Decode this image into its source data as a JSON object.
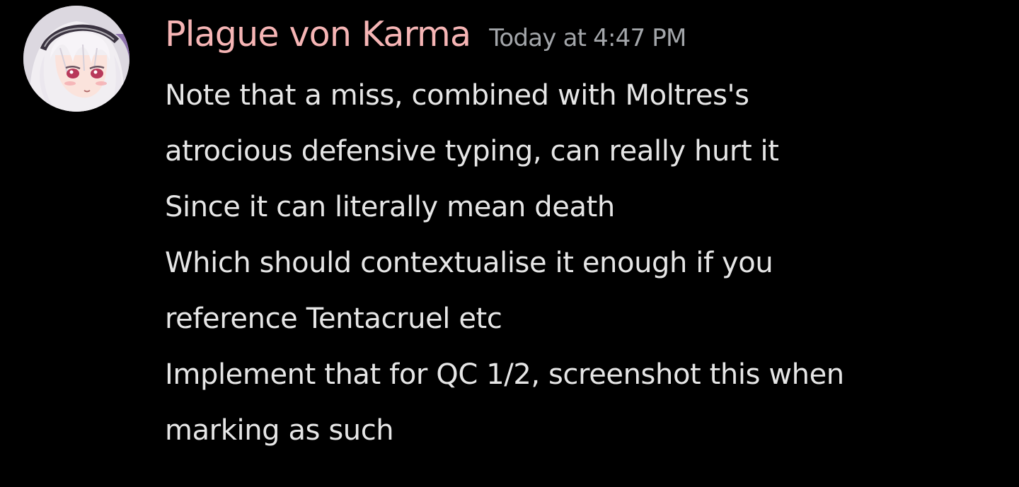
{
  "colors": {
    "background": "#000000",
    "username": "#F6B5B5",
    "timestamp": "#A3A6AA",
    "message_text": "#E6E6E6"
  },
  "message": {
    "author": "Plague von Karma",
    "timestamp": "Today at 4:47 PM",
    "avatar_icon": "anime-character-avatar",
    "lines": [
      "Note that a miss, combined with Moltres's",
      "atrocious defensive typing, can really hurt it",
      "Since it can literally mean death",
      "Which should contextualise it enough if you",
      "reference Tentacruel etc",
      "Implement that for QC 1/2, screenshot this when",
      "marking as such"
    ]
  }
}
